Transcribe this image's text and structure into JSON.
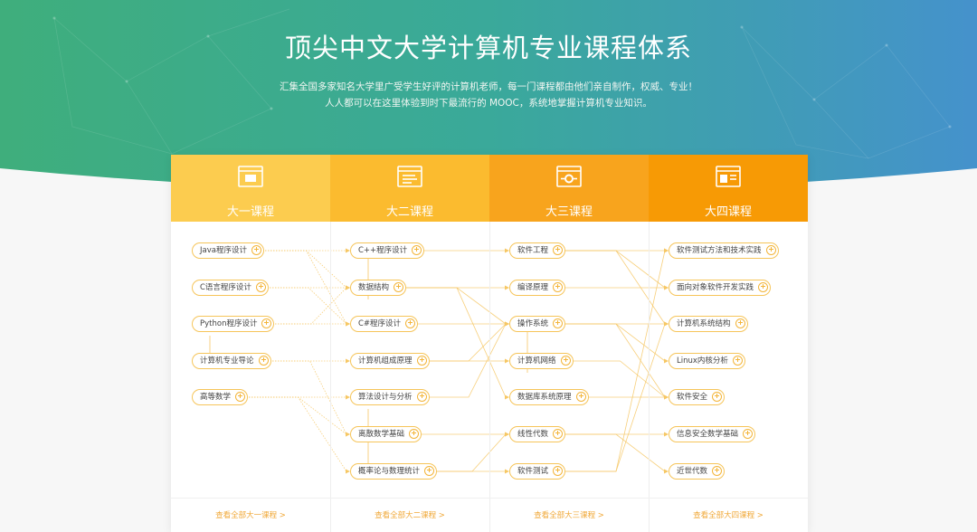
{
  "header": {
    "title": "顶尖中文大学计算机专业课程体系",
    "subtitle_line1": "汇集全国多家知名大学里广受学生好评的计算机老师，每一门课程都由他们亲自制作，权威、专业！",
    "subtitle_line2": "人人都可以在这里体验到时下最流行的 MOOC，系统地掌握计算机专业知识。"
  },
  "colors": {
    "hero_left": "#3fae7c",
    "hero_right": "#4592cc",
    "col1": "#fccc4f",
    "col2": "#fbbb2f",
    "col3": "#f8a41d",
    "col4": "#f79a05",
    "pill_border": "#f6c55a",
    "link_text": "#f0a838"
  },
  "columns": [
    {
      "label": "大一课程",
      "icon": "book-window-icon",
      "more": "查看全部大一课程 >",
      "courses": [
        "Java程序设计",
        "C语言程序设计",
        "Python程序设计",
        "计算机专业导论",
        "高等数学"
      ]
    },
    {
      "label": "大二课程",
      "icon": "code-window-icon",
      "more": "查看全部大二课程 >",
      "courses": [
        "C++程序设计",
        "数据结构",
        "C#程序设计",
        "计算机组成原理",
        "算法设计与分析",
        "离散数学基础",
        "概率论与数理统计"
      ]
    },
    {
      "label": "大三课程",
      "icon": "gear-window-icon",
      "more": "查看全部大三课程 >",
      "courses": [
        "软件工程",
        "编译原理",
        "操作系统",
        "计算机网络",
        "数据库系统原理",
        "线性代数",
        "软件测试"
      ]
    },
    {
      "label": "大四课程",
      "icon": "layout-window-icon",
      "more": "查看全部大四课程 >",
      "courses": [
        "软件测试方法和技术实践",
        "面向对象软件开发实践",
        "计算机系统结构",
        "Linux内核分析",
        "软件安全",
        "信息安全数学基础",
        "近世代数"
      ]
    }
  ]
}
